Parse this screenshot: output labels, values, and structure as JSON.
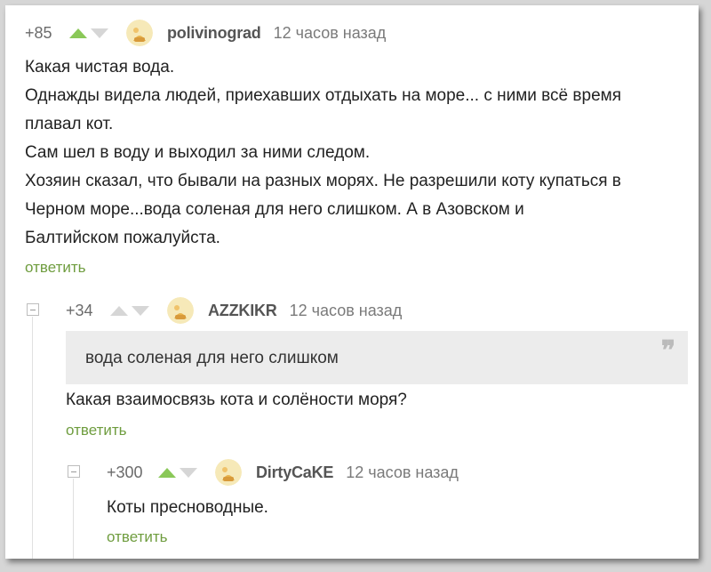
{
  "comments": [
    {
      "rating": "+85",
      "vote": "up",
      "author": "polivinograd",
      "time": "12 часов назад",
      "lines": [
        "Какая чистая вода.",
        "Однажды видела людей, приехавших отдыхать на море... с ними всё время",
        "плавал кот.",
        "Сам шел в воду и выходил за ними следом.",
        "Хозяин сказал, что бывали на разных морях. Не разрешили коту купаться в",
        "Черном море...вода соленая для него слишком. А в Азовском и",
        "Балтийском пожалуйста."
      ],
      "reply_label": "ответить"
    },
    {
      "rating": "+34",
      "vote": "none",
      "author": "AZZKIKR",
      "time": "12 часов назад",
      "quote": "вода соленая для него слишком",
      "quote_icon": "quote-icon",
      "text": "Какая взаимосвязь кота и солёности моря?",
      "reply_label": "ответить"
    },
    {
      "rating": "+300",
      "vote": "up",
      "author": "DirtyCaKE",
      "time": "12 часов назад",
      "text": "Коты пресноводные.",
      "reply_label": "ответить"
    }
  ],
  "colors": {
    "upvote_active": "#8ac858",
    "reply_link": "#6f9d3f",
    "muted": "#7a7a7a"
  }
}
